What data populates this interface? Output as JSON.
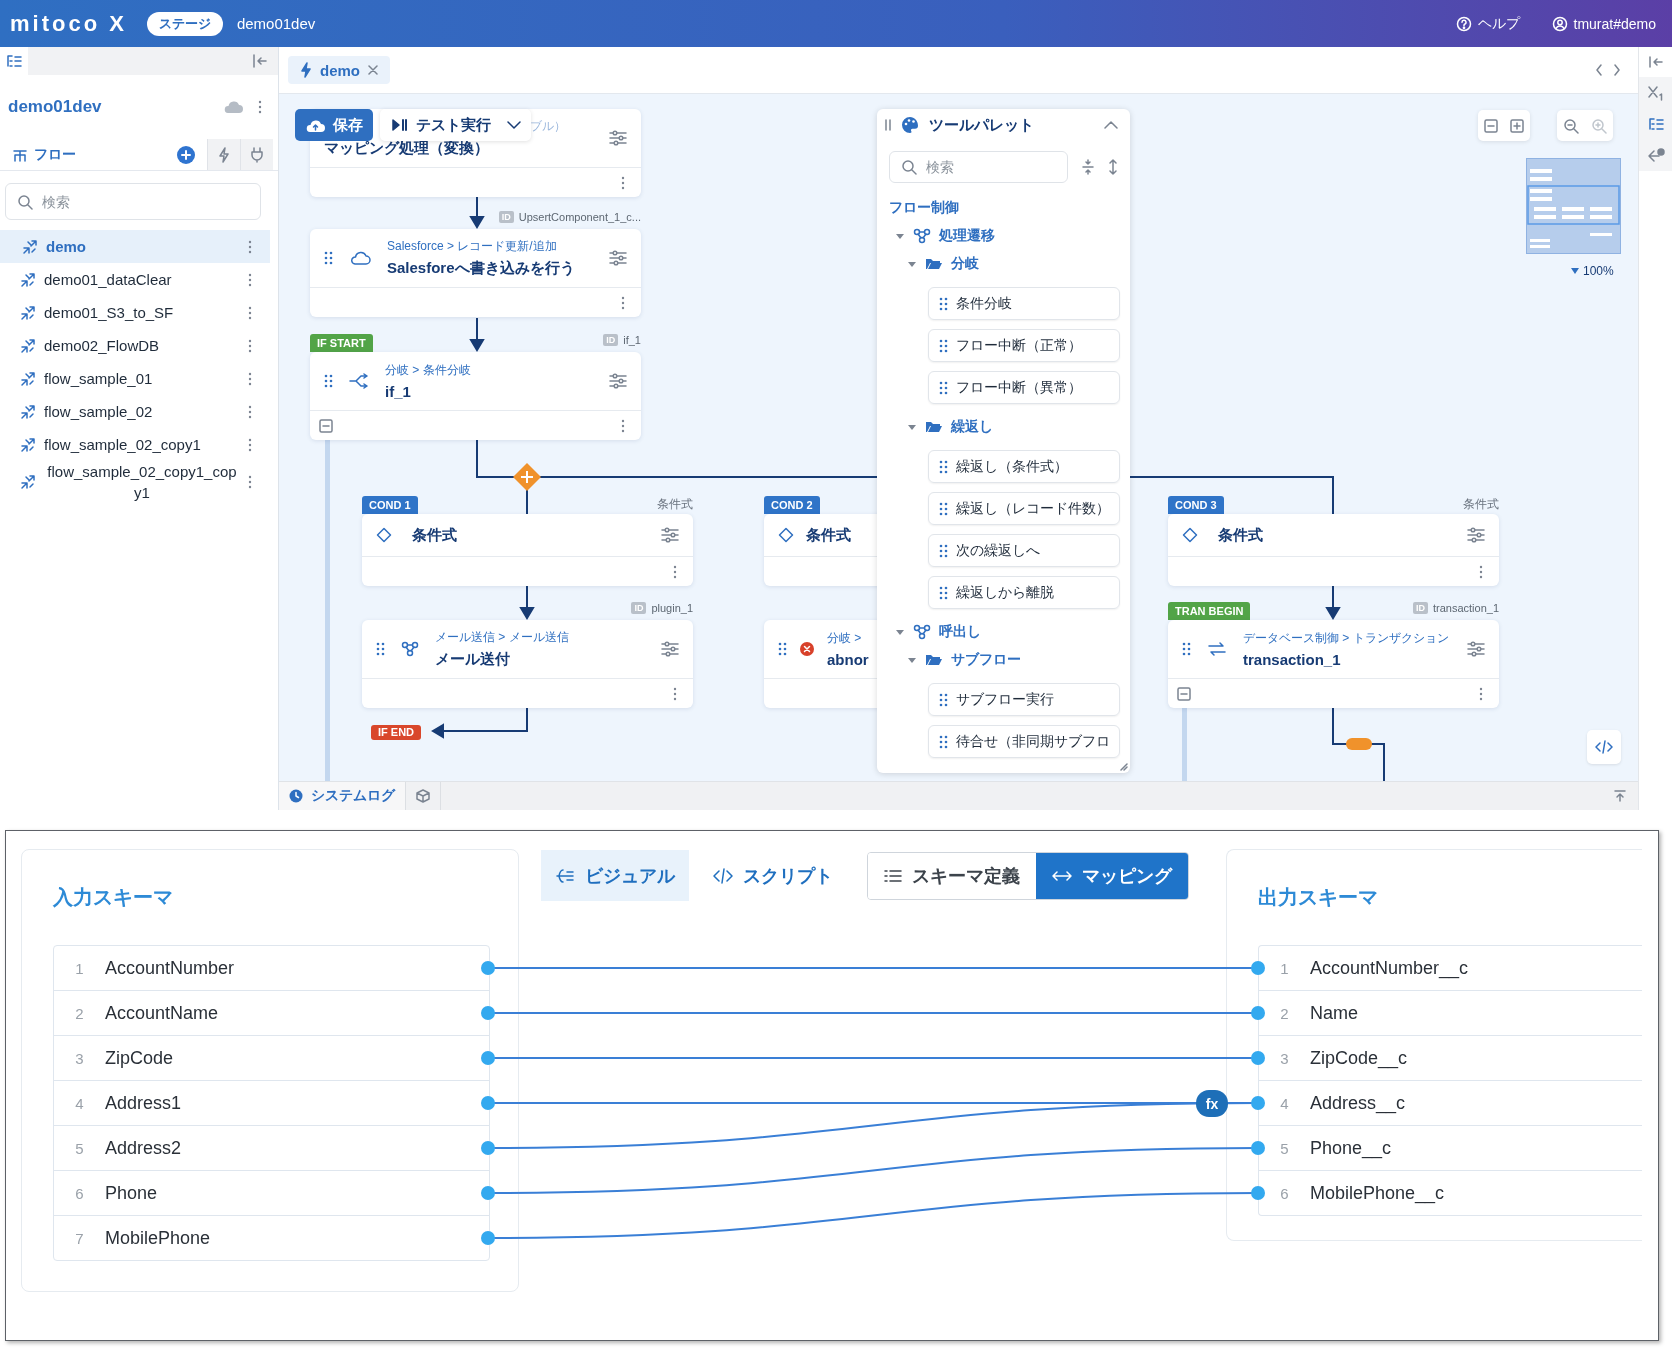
{
  "header": {
    "logo": "mitoco X",
    "stage_badge": "ステージ",
    "org": "demo01dev",
    "help": "ヘルプ",
    "user": "tmurat#demo"
  },
  "sidebar": {
    "org_name": "demo01dev",
    "tabs": [
      {
        "kind": "flow",
        "label": "フロー",
        "selected": true
      },
      {
        "kind": "trigger",
        "selected": false
      },
      {
        "kind": "connector",
        "selected": false
      }
    ],
    "search_placeholder": "検索",
    "flows": [
      {
        "name": "demo",
        "selected": true
      },
      {
        "name": "demo01_dataClear",
        "selected": false
      },
      {
        "name": "demo01_S3_to_SF",
        "selected": false
      },
      {
        "name": "demo02_FlowDB",
        "selected": false
      },
      {
        "name": "flow_sample_01",
        "selected": false
      },
      {
        "name": "flow_sample_02",
        "selected": false
      },
      {
        "name": "flow_sample_02_copy1",
        "selected": false
      },
      {
        "name": "flow_sample_02_copy1_copy1",
        "selected": false
      }
    ]
  },
  "editor_tabs": [
    {
      "label": "demo",
      "selected": true
    }
  ],
  "toolbar": {
    "save": "保存",
    "test_run": "テスト実行"
  },
  "canvas": {
    "zoom": "100%",
    "end_badge": "IF END",
    "nodes": [
      {
        "kind": "mapper",
        "category": "ブル）",
        "title": "マッピング処理（変換）",
        "collapsible": false
      },
      {
        "kind": "salesforce",
        "id_tag": "ID",
        "id": "UpsertComponent_1_c...",
        "category": "Salesforce > レコード更新/追加",
        "title": "Salesforeへ書き込みを行う",
        "collapsible": false
      },
      {
        "kind": "branch",
        "badge": {
          "text": "IF START",
          "kind": "start"
        },
        "id_tag": "ID",
        "id": "if_1",
        "category": "分岐 > 条件分岐",
        "title": "if_1",
        "collapsible": true
      },
      {
        "kind": "condition",
        "badge": {
          "text": "COND 1",
          "kind": "cond"
        },
        "side_label": "条件式",
        "title": "条件式",
        "collapsible": false
      },
      {
        "kind": "mail",
        "id_tag": "ID",
        "id": "plugin_1",
        "category": "メール送信 > メール送信",
        "title": "メール送付",
        "collapsible": false
      },
      {
        "kind": "condition",
        "badge": {
          "text": "COND 2",
          "kind": "cond"
        },
        "title": "条件式",
        "collapsible": false
      },
      {
        "kind": "abort",
        "category": "分岐 >",
        "title": "abnor",
        "collapsible": false
      },
      {
        "kind": "condition",
        "badge": {
          "text": "COND 3",
          "kind": "cond"
        },
        "side_label": "条件式",
        "title": "条件式",
        "collapsible": false
      },
      {
        "kind": "transaction",
        "badge": {
          "text": "TRAN BEGIN",
          "kind": "start"
        },
        "id_tag": "ID",
        "id": "transaction_1",
        "category": "データベース制御 > トランザクション",
        "title": "transaction_1",
        "collapsible": true
      }
    ]
  },
  "palette": {
    "title": "ツールパレット",
    "search_placeholder": "検索",
    "tree": [
      {
        "kind": "section",
        "label": "フロー制御",
        "children": [
          {
            "kind": "group",
            "label": "処理遷移",
            "expanded": true,
            "children": [
              {
                "kind": "folder",
                "label": "分岐",
                "expanded": true,
                "children": [
                  {
                    "kind": "item",
                    "label": "条件分岐"
                  },
                  {
                    "kind": "item",
                    "label": "フロー中断（正常）"
                  },
                  {
                    "kind": "item",
                    "label": "フロー中断（異常）"
                  }
                ]
              },
              {
                "kind": "folder",
                "label": "繰返し",
                "expanded": true,
                "children": [
                  {
                    "kind": "item",
                    "label": "繰返し（条件式）"
                  },
                  {
                    "kind": "item",
                    "label": "繰返し（レコード件数）"
                  },
                  {
                    "kind": "item",
                    "label": "次の繰返しへ"
                  },
                  {
                    "kind": "item",
                    "label": "繰返しから離脱"
                  }
                ]
              }
            ]
          },
          {
            "kind": "group",
            "label": "呼出し",
            "expanded": true,
            "children": [
              {
                "kind": "folder",
                "label": "サブフロー",
                "expanded": true,
                "children": [
                  {
                    "kind": "item",
                    "label": "サブフロー実行"
                  },
                  {
                    "kind": "item",
                    "label": "待合せ（非同期サブフロ"
                  }
                ]
              }
            ]
          }
        ]
      }
    ]
  },
  "bottom_bar": {
    "system_log": "システムログ"
  },
  "mapping": {
    "view_tabs": [
      {
        "kind": "visual",
        "label": "ビジュアル",
        "selected": true
      },
      {
        "kind": "script",
        "label": "スクリプト",
        "selected": false
      }
    ],
    "modes": [
      {
        "kind": "schema",
        "label": "スキーマ定義",
        "selected": false
      },
      {
        "kind": "mapping",
        "label": "マッピング",
        "selected": true
      }
    ],
    "input": {
      "title": "入力スキーマ",
      "fields": [
        {
          "no": "1",
          "name": "AccountNumber"
        },
        {
          "no": "2",
          "name": "AccountName"
        },
        {
          "no": "3",
          "name": "ZipCode"
        },
        {
          "no": "4",
          "name": "Address1"
        },
        {
          "no": "5",
          "name": "Address2"
        },
        {
          "no": "6",
          "name": "Phone"
        },
        {
          "no": "7",
          "name": "MobilePhone"
        }
      ]
    },
    "output": {
      "title": "出力スキーマ",
      "fields": [
        {
          "no": "1",
          "name": "AccountNumber__c"
        },
        {
          "no": "2",
          "name": "Name"
        },
        {
          "no": "3",
          "name": "ZipCode__c"
        },
        {
          "no": "4",
          "name": "Address__c",
          "transform": "fx"
        },
        {
          "no": "5",
          "name": "Phone__c"
        },
        {
          "no": "6",
          "name": "MobilePhone__c"
        }
      ]
    }
  }
}
